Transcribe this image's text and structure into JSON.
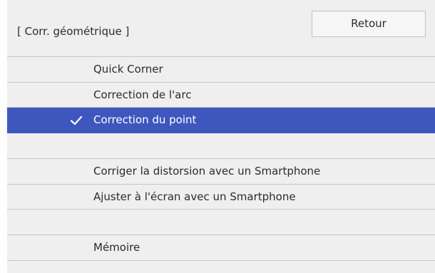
{
  "header": {
    "title": "[ Corr. géométrique ]",
    "back_label": "Retour"
  },
  "menu": {
    "items": [
      {
        "label": "Quick Corner",
        "selected": false
      },
      {
        "label": "Correction de l'arc",
        "selected": false
      },
      {
        "label": "Correction du point",
        "selected": true,
        "icon": "check-icon"
      },
      {
        "label": "",
        "selected": false
      },
      {
        "label": "Corriger la distorsion avec un Smartphone",
        "selected": false
      },
      {
        "label": "Ajuster à l'écran avec un Smartphone",
        "selected": false
      },
      {
        "label": "",
        "selected": false
      },
      {
        "label": "Mémoire",
        "selected": false
      },
      {
        "label": "",
        "selected": false
      }
    ]
  },
  "colors": {
    "selected_bg": "#3e57bf",
    "panel_bg": "#efefef",
    "divider": "#c6c6c6",
    "text": "#2b2b2b"
  }
}
